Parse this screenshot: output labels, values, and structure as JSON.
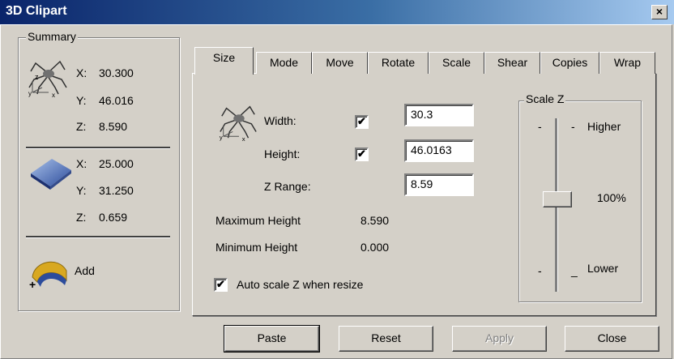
{
  "window": {
    "title": "3D Clipart",
    "close_glyph": "×"
  },
  "summary": {
    "legend": "Summary",
    "clipart": {
      "icon": "spider-3d-icon",
      "x_label": "X:",
      "x": "30.300",
      "y_label": "Y:",
      "y": "46.016",
      "z_label": "Z:",
      "z": "8.590"
    },
    "selection": {
      "icon": "diamond-shape-icon",
      "x_label": "X:",
      "x": "25.000",
      "y_label": "Y:",
      "y": "31.250",
      "z_label": "Z:",
      "z": "0.659"
    },
    "add": {
      "icon": "add-shape-icon",
      "label": "Add"
    }
  },
  "tabs": [
    "Size",
    "Mode",
    "Move",
    "Rotate",
    "Scale",
    "Shear",
    "Copies",
    "Wrap"
  ],
  "size": {
    "width_label": "Width:",
    "width_checked": "✔",
    "width_value": "30.3",
    "height_label": "Height:",
    "height_checked": "✔",
    "height_value": "46.0163",
    "zrange_label": "Z Range:",
    "zrange_value": "8.59",
    "max_label": "Maximum Height",
    "max_value": "8.590",
    "min_label": "Minimum Height",
    "min_value": "0.000",
    "autoscale_label": "Auto scale Z when resize",
    "autoscale_checked": "✔"
  },
  "scale_z": {
    "legend": "Scale Z",
    "higher": "Higher",
    "percent": "100%",
    "lower": "Lower"
  },
  "buttons": {
    "paste": "Paste",
    "reset": "Reset",
    "apply": "Apply",
    "close": "Close"
  }
}
